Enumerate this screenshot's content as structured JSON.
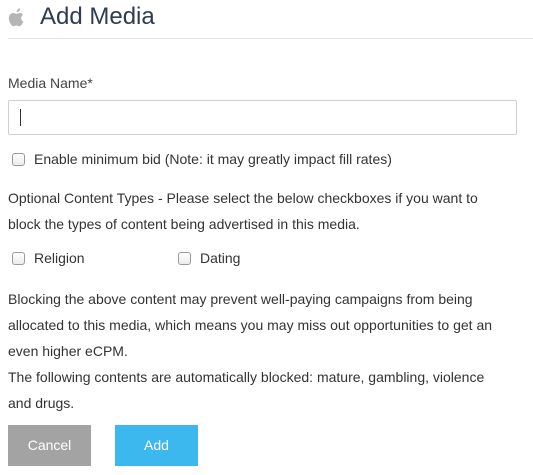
{
  "header": {
    "title": "Add Media",
    "icon": "apple-icon"
  },
  "form": {
    "media_name_label": "Media Name*",
    "media_name_value": "",
    "min_bid_label": "Enable minimum bid (Note: it may greatly impact fill rates)",
    "min_bid_checked": false,
    "content_types_intro": [
      "Optional Content Types - Please select the below checkboxes if you want to",
      "block the types of content being advertised in this media."
    ],
    "content_types": [
      {
        "label": "Religion",
        "checked": false
      },
      {
        "label": "Dating",
        "checked": false
      }
    ],
    "warning_lines": [
      "Blocking the above content may prevent well-paying campaigns from being",
      "allocated to this media, which means you may miss out opportunities to get an",
      "even higher eCPM.",
      "The following contents are automatically blocked: mature, gambling, violence",
      "and drugs."
    ]
  },
  "actions": {
    "cancel_label": "Cancel",
    "add_label": "Add"
  },
  "colors": {
    "title": "#2e3b52",
    "cancel_bg": "#a3a3a3",
    "add_bg": "#3db8ee",
    "divider": "#e3e3e3"
  }
}
